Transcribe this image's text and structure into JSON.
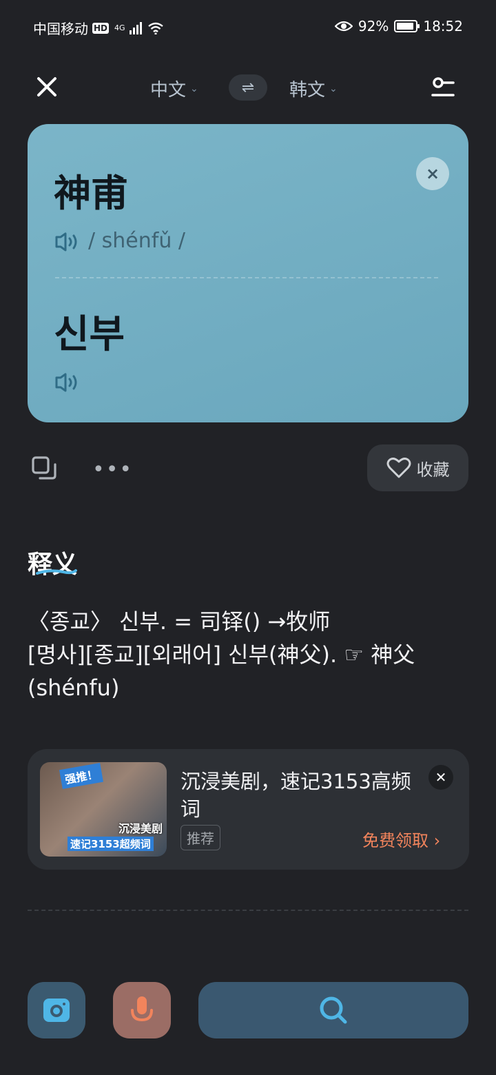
{
  "status_bar": {
    "carrier": "中国移动",
    "hd": "HD",
    "network": "4G",
    "battery_percent": "92%",
    "battery_level": 0.92,
    "time": "18:52"
  },
  "header": {
    "source_language": "中文",
    "target_language": "韩文"
  },
  "result_card": {
    "source_word": "神甫",
    "pinyin": "shénfǔ",
    "pinyin_open": "/",
    "pinyin_close": "/",
    "target_word": "신부",
    "background_color": "#6fadc2"
  },
  "actions": {
    "favorite_label": "收藏",
    "more_label": "•••"
  },
  "definition": {
    "heading": "释义",
    "lines": [
      "〈종교〉 신부. = 司铎() →牧师",
      "[명사][종교][외래어] 신부(神父). ☞ 神父",
      "(shénfu)"
    ]
  },
  "ad": {
    "title": "沉浸美剧，速记3153高频词",
    "badge": "推荐",
    "cta": "免费领取 ›",
    "close_icon": "close-icon",
    "image_tag": "强推！",
    "image_line1": "沉浸美剧",
    "image_line2": "速记3153超频词",
    "cta_color": "#f2845c"
  },
  "colors": {
    "background": "#212226",
    "accent_blue": "#6fadc2",
    "search_icon": "#4fb6e6",
    "mic_icon": "#f2845c"
  }
}
